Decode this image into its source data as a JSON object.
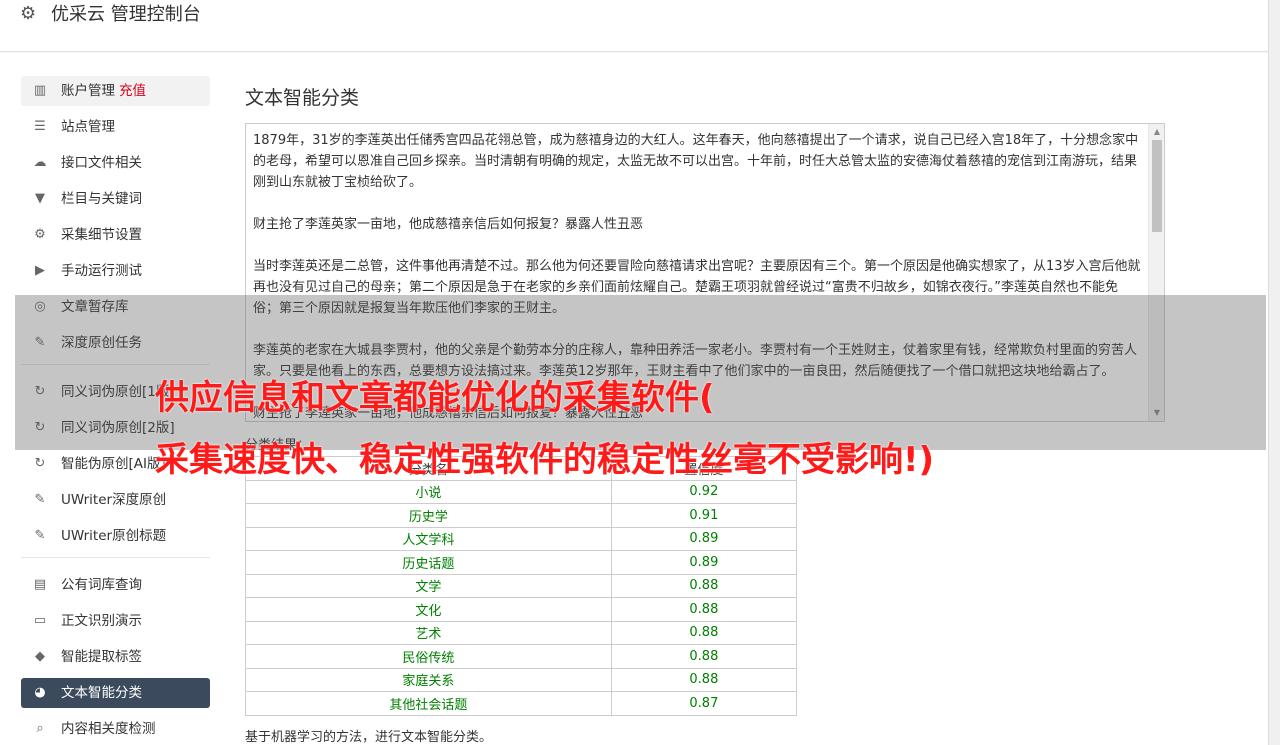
{
  "header": {
    "title": "优采云 管理控制台",
    "icon": "gear-icon"
  },
  "sidebar": {
    "recharge_label": "充值",
    "groups": [
      [
        {
          "label": "账户管理",
          "icon": "bar-chart-icon"
        },
        {
          "label": "站点管理",
          "icon": "server-icon"
        },
        {
          "label": "接口文件相关",
          "icon": "cloud-upload-icon"
        },
        {
          "label": "栏目与关键词",
          "icon": "filter-icon"
        },
        {
          "label": "采集细节设置",
          "icon": "gears-icon"
        },
        {
          "label": "手动运行测试",
          "icon": "play-circle-icon"
        },
        {
          "label": "文章暂存库",
          "icon": "database-icon"
        },
        {
          "label": "深度原创任务",
          "icon": "edit-icon"
        }
      ],
      [
        {
          "label": "同义词伪原创[1版]",
          "icon": "refresh-icon"
        },
        {
          "label": "同义词伪原创[2版]",
          "icon": "refresh-icon"
        },
        {
          "label": "智能伪原创[AI版]",
          "icon": "refresh-icon"
        },
        {
          "label": "UWriter深度原创",
          "icon": "edit-icon"
        },
        {
          "label": "UWriter原创标题",
          "icon": "edit-icon"
        }
      ],
      [
        {
          "label": "公有词库查询",
          "icon": "book-icon"
        },
        {
          "label": "正文识别演示",
          "icon": "monitor-icon"
        },
        {
          "label": "智能提取标签",
          "icon": "tag-icon"
        },
        {
          "label": "文本智能分类",
          "icon": "pie-chart-icon",
          "active": true
        },
        {
          "label": "内容相关度检测",
          "icon": "search-icon"
        }
      ]
    ]
  },
  "main": {
    "title": "文本智能分类",
    "text_paragraphs": [
      "1879年，31岁的李莲英出任储秀宫四品花翎总管，成为慈禧身边的大红人。这年春天，他向慈禧提出了一个请求，说自己已经入宫18年了，十分想念家中的老母，希望可以恩准自己回乡探亲。当时清朝有明确的规定，太监无故不可以出宫。十年前，时任大总管太监的安德海仗着慈禧的宠信到江南游玩，结果刚到山东就被丁宝桢给砍了。",
      "财主抢了李莲英家一亩地，他成慈禧亲信后如何报复？暴露人性丑恶",
      "当时李莲英还是二总管，这件事他再清楚不过。那么他为何还要冒险向慈禧请求出宫呢？主要原因有三个。第一个原因是他确实想家了，从13岁入宫后他就再也没有见过自己的母亲；第二个原因是急于在老家的乡亲们面前炫耀自己。楚霸王项羽就曾经说过“富贵不归故乡，如锦衣夜行。”李莲英自然也不能免俗；第三个原因就是报复当年欺压他们李家的王财主。",
      "李莲英的老家在大城县李贾村，他的父亲是个勤劳本分的庄稼人，靠种田养活一家老小。李贾村有一个王姓财主，仗着家里有钱，经常欺负村里面的穷苦人家。只要是他看上的东西，总要想方设法搞过来。李莲英12岁那年，王财主看中了他们家中的一亩良田，然后随便找了一个借口就把这块地给霸占了。",
      "财主抢了李莲英家一亩地，他成慈禧亲信后如何报复？暴露人性丑恶"
    ],
    "result_label": "分类结果：",
    "table": {
      "headers": [
        "分类名",
        "置信度"
      ],
      "rows": [
        [
          "小说",
          "0.92"
        ],
        [
          "历史学",
          "0.91"
        ],
        [
          "人文学科",
          "0.89"
        ],
        [
          "历史话题",
          "0.89"
        ],
        [
          "文学",
          "0.88"
        ],
        [
          "文化",
          "0.88"
        ],
        [
          "艺术",
          "0.88"
        ],
        [
          "民俗传统",
          "0.88"
        ],
        [
          "家庭关系",
          "0.88"
        ],
        [
          "其他社会话题",
          "0.87"
        ]
      ]
    },
    "footnote": "基于机器学习的方法，进行文本智能分类。"
  },
  "overlay": {
    "line1": "供应信息和文章都能优化的采集软件(",
    "line2": "采集速度快、稳定性强软件的稳定性丝毫不受影响!)"
  },
  "colors": {
    "active_nav_bg": "#3b4a5c",
    "recharge": "#d9001b",
    "result_value": "#008000",
    "overlay_text": "#ff1a1a"
  }
}
